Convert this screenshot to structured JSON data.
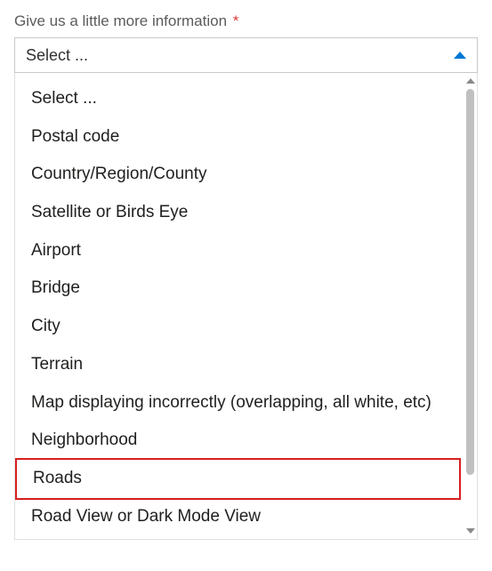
{
  "form": {
    "label": "Give us a little more information",
    "required_marker": "*"
  },
  "select": {
    "placeholder": "Select ..."
  },
  "options": [
    {
      "label": "Select ...",
      "highlighted": false
    },
    {
      "label": "Postal code",
      "highlighted": false
    },
    {
      "label": "Country/Region/County",
      "highlighted": false
    },
    {
      "label": "Satellite or Birds Eye",
      "highlighted": false
    },
    {
      "label": "Airport",
      "highlighted": false
    },
    {
      "label": "Bridge",
      "highlighted": false
    },
    {
      "label": "City",
      "highlighted": false
    },
    {
      "label": "Terrain",
      "highlighted": false
    },
    {
      "label": "Map displaying incorrectly (overlapping, all white, etc)",
      "highlighted": false
    },
    {
      "label": "Neighborhood",
      "highlighted": false
    },
    {
      "label": "Roads",
      "highlighted": true
    },
    {
      "label": "Road View or Dark Mode View",
      "highlighted": false
    }
  ]
}
